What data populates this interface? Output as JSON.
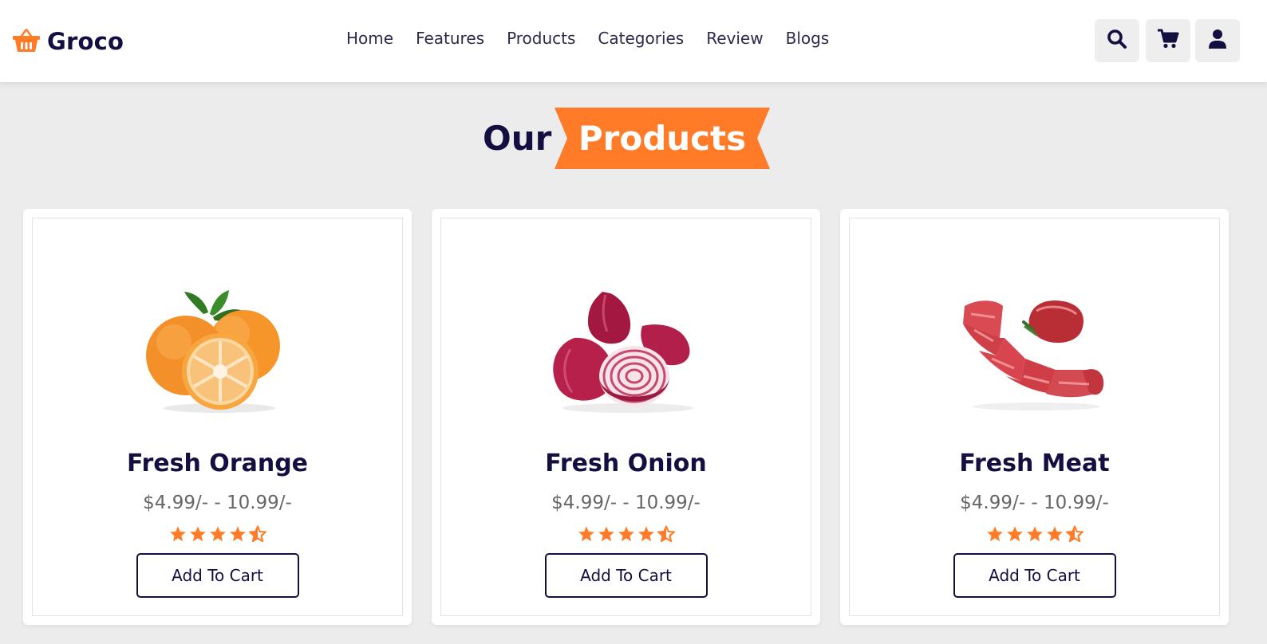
{
  "colors": {
    "accent": "#ff7b28",
    "dark": "#130f40",
    "page_bg": "#ececec"
  },
  "header": {
    "logo_icon": "basket-icon",
    "logo_text": "Groco",
    "nav": [
      "Home",
      "Features",
      "Products",
      "Categories",
      "Review",
      "Blogs"
    ],
    "icons": [
      "search-icon",
      "cart-icon",
      "user-icon"
    ]
  },
  "heading": {
    "prefix": "Our",
    "highlight": "Products"
  },
  "products": [
    {
      "name": "Fresh Orange",
      "price": "$4.99/- - 10.99/-",
      "rating": 4.5,
      "button": "Add To Cart",
      "image": "orange-image"
    },
    {
      "name": "Fresh Onion",
      "price": "$4.99/- - 10.99/-",
      "rating": 4.5,
      "button": "Add To Cart",
      "image": "onion-image"
    },
    {
      "name": "Fresh Meat",
      "price": "$4.99/- - 10.99/-",
      "rating": 4.5,
      "button": "Add To Cart",
      "image": "meat-image"
    }
  ]
}
